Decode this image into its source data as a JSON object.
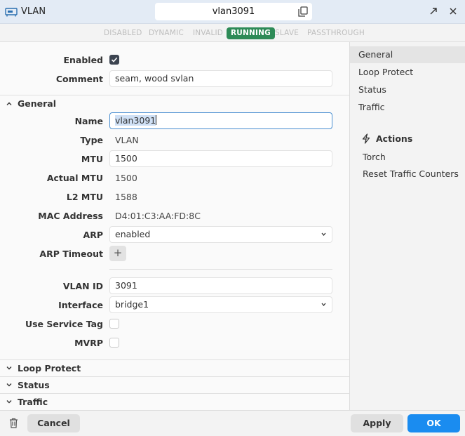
{
  "window": {
    "title": "VLAN",
    "name": "vlan3091"
  },
  "flags": [
    {
      "label": "DISABLED",
      "active": false
    },
    {
      "label": "DYNAMIC",
      "active": false
    },
    {
      "label": "INVALID",
      "active": false
    },
    {
      "label": "RUNNING",
      "active": true
    },
    {
      "label": "SLAVE",
      "active": false
    },
    {
      "label": "PASSTHROUGH",
      "active": false
    }
  ],
  "form": {
    "enabled_label": "Enabled",
    "enabled": true,
    "comment_label": "Comment",
    "comment": "seam, wood svlan",
    "general": {
      "title": "General",
      "name_label": "Name",
      "name": "vlan3091",
      "type_label": "Type",
      "type": "VLAN",
      "mtu_label": "MTU",
      "mtu": "1500",
      "actual_mtu_label": "Actual MTU",
      "actual_mtu": "1500",
      "l2mtu_label": "L2 MTU",
      "l2mtu": "1588",
      "mac_label": "MAC Address",
      "mac": "D4:01:C3:AA:FD:8C",
      "arp_label": "ARP",
      "arp": "enabled",
      "arp_timeout_label": "ARP Timeout",
      "arp_timeout_add": "+",
      "vlan_id_label": "VLAN ID",
      "vlan_id": "3091",
      "interface_label": "Interface",
      "interface": "bridge1",
      "service_tag_label": "Use Service Tag",
      "service_tag": false,
      "mvrp_label": "MVRP",
      "mvrp": false
    },
    "sections": [
      "Loop Protect",
      "Status",
      "Traffic"
    ]
  },
  "sidebar": {
    "nav": [
      "General",
      "Loop Protect",
      "Status",
      "Traffic"
    ],
    "active": "General",
    "actions_title": "Actions",
    "actions": [
      "Torch",
      "Reset Traffic Counters"
    ]
  },
  "footer": {
    "cancel": "Cancel",
    "apply": "Apply",
    "ok": "OK"
  },
  "colors": {
    "accent": "#1a8cf0",
    "running": "#2e8b57",
    "focus": "#4a8fd1"
  }
}
